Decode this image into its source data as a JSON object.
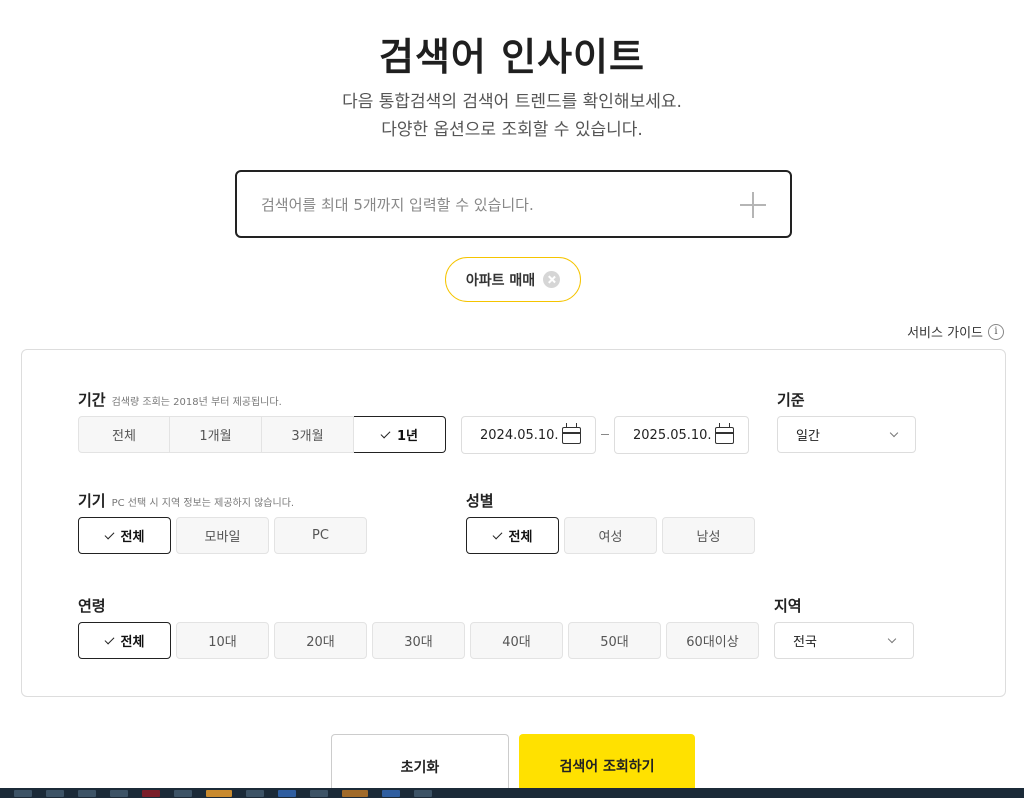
{
  "header": {
    "title": "검색어 인사이트",
    "subtitle_line1": "다음 통합검색의 검색어 트렌드를 확인해보세요.",
    "subtitle_line2": "다양한 옵션으로 조회할 수 있습니다."
  },
  "search": {
    "placeholder": "검색어를 최대 5개까지 입력할 수 있습니다.",
    "value": ""
  },
  "keywords": [
    {
      "label": "아파트 매매"
    }
  ],
  "guide": {
    "label": "서비스 가이드",
    "icon_text": "i"
  },
  "period": {
    "label": "기간",
    "note": "검색량 조회는 2018년 부터 제공됩니다.",
    "options": [
      "전체",
      "1개월",
      "3개월",
      "1년"
    ],
    "selected": "1년",
    "start_date": "2024.05.10.",
    "end_date": "2025.05.10."
  },
  "basis": {
    "label": "기준",
    "value": "일간"
  },
  "device": {
    "label": "기기",
    "note": "PC 선택 시 지역 정보는 제공하지 않습니다.",
    "options": [
      "전체",
      "모바일",
      "PC"
    ],
    "selected": "전체"
  },
  "gender": {
    "label": "성별",
    "options": [
      "전체",
      "여성",
      "남성"
    ],
    "selected": "전체"
  },
  "age": {
    "label": "연령",
    "options": [
      "전체",
      "10대",
      "20대",
      "30대",
      "40대",
      "50대",
      "60대이상"
    ],
    "selected": "전체"
  },
  "region": {
    "label": "지역",
    "value": "전국"
  },
  "actions": {
    "reset_label": "초기화",
    "search_label": "검색어 조회하기"
  },
  "colors": {
    "accent": "#ffe100",
    "chip_border": "#f5c400"
  }
}
